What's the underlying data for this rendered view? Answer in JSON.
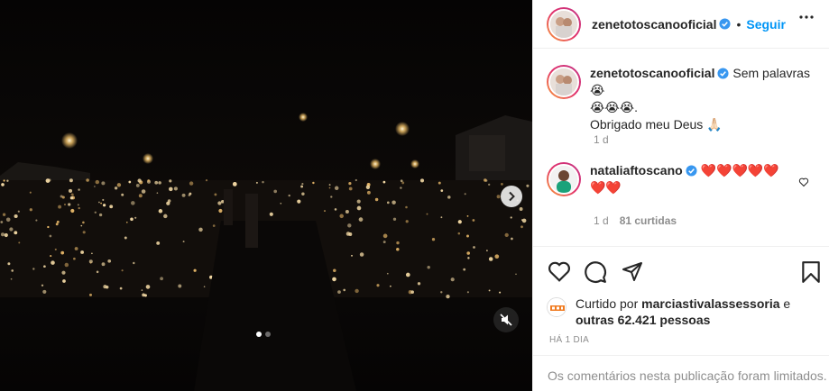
{
  "post": {
    "author": "zenetotoscanooficial",
    "separator": "•",
    "follow_label": "Seguir"
  },
  "caption": {
    "username": "zenetotoscanooficial",
    "line1": "Sem palavras😭",
    "line2": "😭😭😭.",
    "line3": "Obrigado meu Deus 🙏🏻",
    "time": "1 d"
  },
  "comment": {
    "username": "nataliaftoscano",
    "text1": "❤️❤️❤️❤️❤️",
    "text2": "❤️❤️",
    "time": "1 d",
    "likes": "81 curtidas"
  },
  "likes": {
    "prefix": "Curtido por",
    "user": "marciastivalassessoria",
    "connector": "e",
    "others": "outras 62.421 pessoas"
  },
  "timestamp": "HÁ 1 DIA",
  "comments_limited": "Os comentários nesta publicação foram limitados.",
  "carousel": {
    "count": 2,
    "active": 0
  },
  "icons": {
    "verified": "verified-badge-icon",
    "more": "more-options-icon",
    "like": "heart-icon",
    "comment": "comment-icon",
    "share": "share-icon",
    "save": "bookmark-icon",
    "next": "chevron-right-icon",
    "mute": "muted-speaker-icon"
  },
  "colors": {
    "accent": "#0095f6",
    "verified": "#3897f0",
    "heart": "#ed1c24",
    "muted_text": "#8e8e8e"
  }
}
